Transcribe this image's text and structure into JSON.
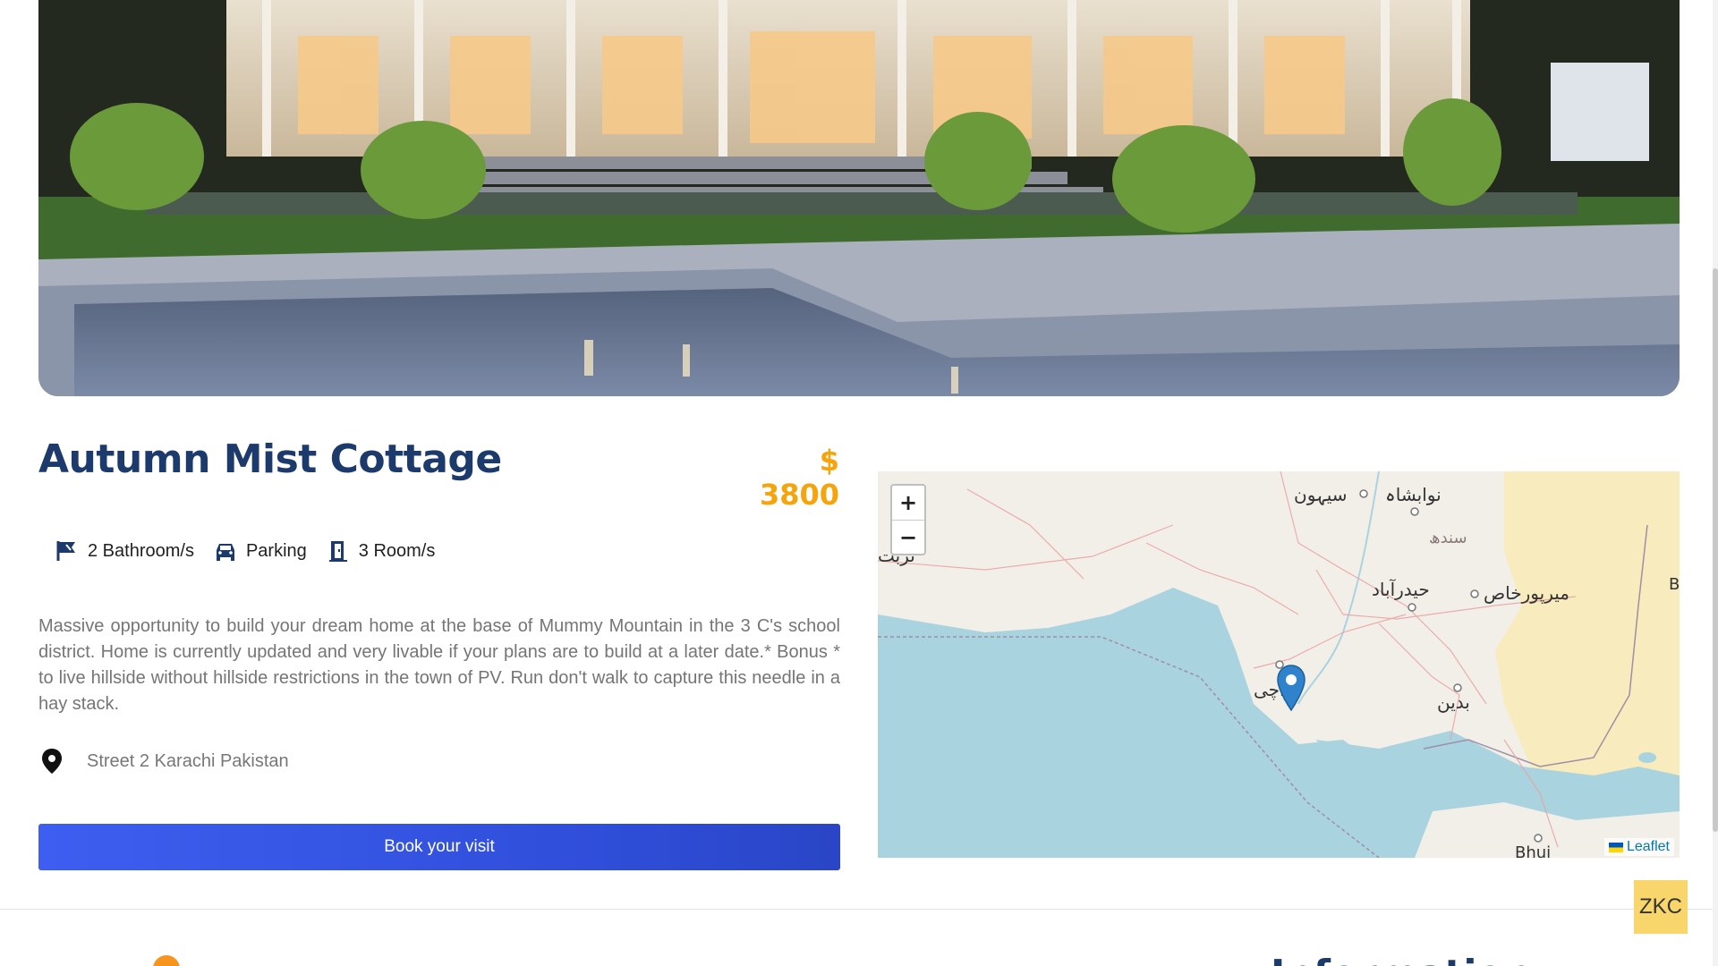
{
  "property": {
    "title": "Autumn Mist Cottage",
    "price": "$ 3800",
    "features": [
      {
        "icon": "bathroom-icon",
        "label": "2 Bathroom/s"
      },
      {
        "icon": "car-icon",
        "label": "Parking"
      },
      {
        "icon": "door-icon",
        "label": "3 Room/s"
      }
    ],
    "description": "Massive opportunity to build your dream home at the base of Mummy Mountain in the 3 C's school district. Home is currently updated and very livable if your plans are to build at a later date.* Bonus * to live hillside without hillside restrictions in the town of PV. Run don't walk to capture this needle in a hay stack.",
    "address": "Street 2 Karachi Pakistan",
    "book_label": "Book your visit"
  },
  "map": {
    "zoom_in": "+",
    "zoom_out": "−",
    "attribution": "Leaflet",
    "labels": {
      "nawabshah": "نوابشاہ",
      "sehwan": "سیہون",
      "sindh": "سندھ",
      "hyderabad": "حیدرآباد",
      "mirpurkhas": "میرپورخاص",
      "karachi": "کراچی",
      "badin": "بدین",
      "turbat": "تربت",
      "bhuj": "Bhuj",
      "edge_b": "B"
    }
  },
  "footer": {
    "badge": "ZKC",
    "section_heading": "Information"
  },
  "colors": {
    "title": "#1c3a6b",
    "price": "#f5a40c",
    "button": "#3d5ef0",
    "badge": "#f9d66b"
  }
}
